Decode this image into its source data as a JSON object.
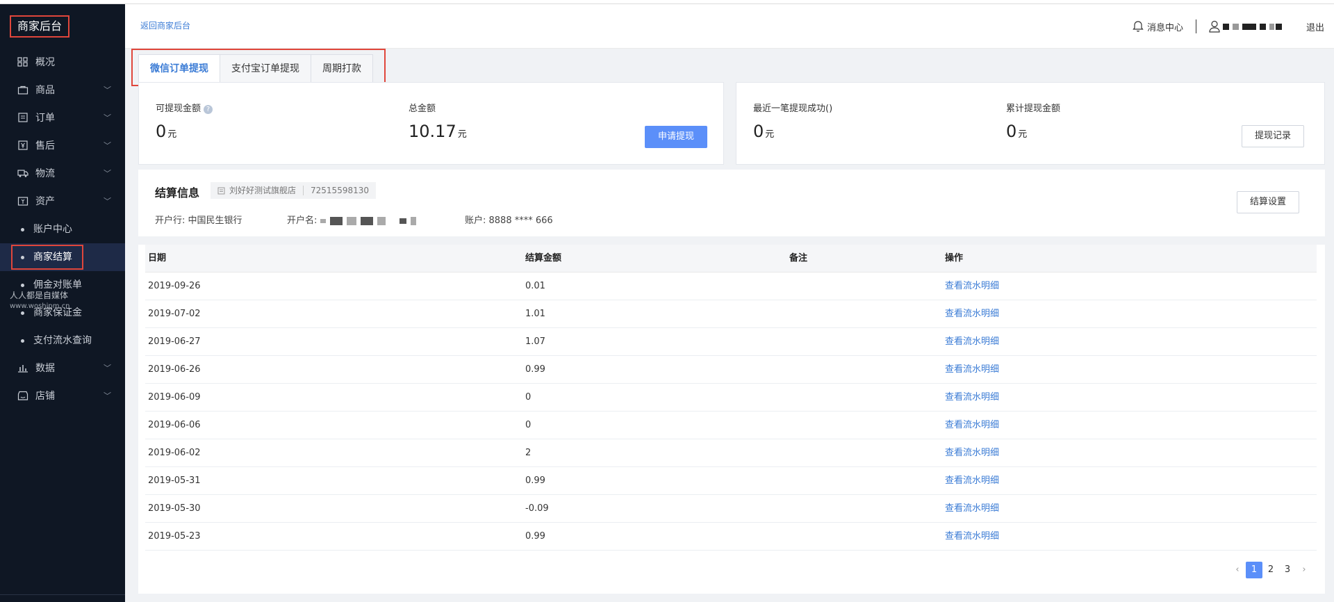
{
  "sidebar": {
    "brand": "商家后台",
    "items": [
      {
        "label": "概况",
        "icon": "grid-icon",
        "has_chevron": false
      },
      {
        "label": "商品",
        "icon": "bag-icon",
        "has_chevron": true
      },
      {
        "label": "订单",
        "icon": "list-icon",
        "has_chevron": true
      },
      {
        "label": "售后",
        "icon": "yen-box-icon",
        "has_chevron": true
      },
      {
        "label": "物流",
        "icon": "truck-icon",
        "has_chevron": true
      },
      {
        "label": "资产",
        "icon": "asset-icon",
        "has_chevron": true
      }
    ],
    "asset_sub_items": [
      "账户中心",
      "商家结算",
      "佣金对账单",
      "商家保证金",
      "支付流水查询"
    ],
    "active_sub_item": "商家结算",
    "bottom_items": [
      {
        "label": "数据",
        "icon": "bar-chart-icon",
        "has_chevron": true
      },
      {
        "label": "店铺",
        "icon": "store-icon",
        "has_chevron": true
      }
    ],
    "watermark": {
      "line1": "人人都是自媒体",
      "line2": "www.woshipm.cn"
    }
  },
  "header": {
    "back_link": "返回商家后台",
    "message_center": "消息中心",
    "logout": "退出"
  },
  "tabs": [
    {
      "label": "微信订单提现",
      "active": true
    },
    {
      "label": "支付宝订单提现",
      "active": false
    },
    {
      "label": "周期打款",
      "active": false
    }
  ],
  "withdraw_card": {
    "available_label": "可提现金额",
    "available_value": "0",
    "total_label": "总金额",
    "total_value": "10.17",
    "unit": "元",
    "apply_button": "申请提现"
  },
  "history_card": {
    "last_success_label": "最近一笔提现成功()",
    "last_success_value": "0",
    "cumulative_label": "累计提现金额",
    "cumulative_value": "0",
    "unit": "元",
    "record_button": "提现记录"
  },
  "settlement": {
    "title": "结算信息",
    "shop_name": "刘好好测试旗舰店",
    "shop_id": "72515598130",
    "bank_label": "开户行: 中国民生银行",
    "account_name_label": "开户名:",
    "account_label": "账户: 8888 **** 666",
    "settings_button": "结算设置"
  },
  "table": {
    "columns": [
      "日期",
      "结算金额",
      "备注",
      "操作"
    ],
    "action_text": "查看流水明细",
    "rows": [
      {
        "date": "2019-09-26",
        "amount": "0.01",
        "note": ""
      },
      {
        "date": "2019-07-02",
        "amount": "1.01",
        "note": ""
      },
      {
        "date": "2019-06-27",
        "amount": "1.07",
        "note": ""
      },
      {
        "date": "2019-06-26",
        "amount": "0.99",
        "note": ""
      },
      {
        "date": "2019-06-09",
        "amount": "0",
        "note": ""
      },
      {
        "date": "2019-06-06",
        "amount": "0",
        "note": ""
      },
      {
        "date": "2019-06-02",
        "amount": "2",
        "note": ""
      },
      {
        "date": "2019-05-31",
        "amount": "0.99",
        "note": ""
      },
      {
        "date": "2019-05-30",
        "amount": "-0.09",
        "note": ""
      },
      {
        "date": "2019-05-23",
        "amount": "0.99",
        "note": ""
      }
    ]
  },
  "pagination": {
    "pages": [
      "1",
      "2",
      "3"
    ],
    "current": "1",
    "prev": "‹",
    "next": "›"
  },
  "colors": {
    "accent": "#5b8ff9",
    "link": "#3a7bd5",
    "highlight": "#e0463b",
    "sidebar_bg": "#0f1724"
  }
}
